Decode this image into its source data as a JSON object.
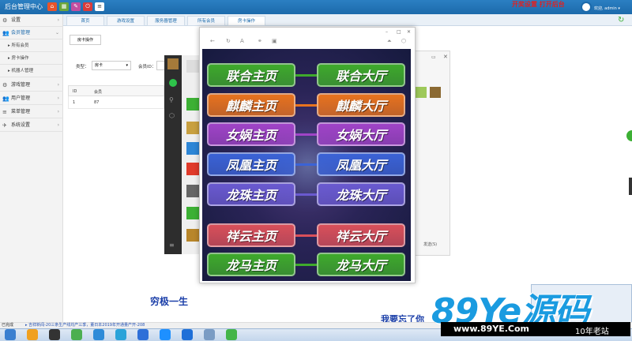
{
  "app": {
    "title": "后台管理中心",
    "top_hint": "开奖设置 打开后台",
    "welcome": "欢迎, admin ▾"
  },
  "toolbar": [
    {
      "icon": "home-icon",
      "glyph": "⌂",
      "color": "#e8542b"
    },
    {
      "icon": "grid-icon",
      "glyph": "▦",
      "color": "#6aa53a"
    },
    {
      "icon": "edit-icon",
      "glyph": "✎",
      "color": "#c24ea0"
    },
    {
      "icon": "power-icon",
      "glyph": "⏻",
      "color": "#d93b3b"
    },
    {
      "icon": "list-icon",
      "glyph": "≡",
      "color": "#ffffff"
    }
  ],
  "sidebar": {
    "items": [
      {
        "label": "设置",
        "icon": "⚙"
      },
      {
        "label": "会员管理",
        "icon": "👥"
      },
      {
        "label": "所有会员",
        "sub": true
      },
      {
        "label": "房卡操作",
        "sub": true
      },
      {
        "label": "机器人管理",
        "sub": true
      },
      {
        "label": "游戏管理",
        "icon": "⚙"
      },
      {
        "label": "用户管理",
        "icon": "👥"
      },
      {
        "label": "菜单管理",
        "icon": "≡"
      },
      {
        "label": "系统设置",
        "icon": "✈"
      }
    ]
  },
  "tabs": [
    {
      "label": "首页"
    },
    {
      "label": "游戏设置"
    },
    {
      "label": "服务器管理"
    },
    {
      "label": "所有会员"
    },
    {
      "label": "房卡操作",
      "active": true
    }
  ],
  "content": {
    "subtab": "房卡操作",
    "filter_type_label": "类型：",
    "filter_type_value": "房卡",
    "filter_member_label": "会员ID：",
    "table_headers": [
      "ID",
      "会员"
    ],
    "table_rows": [
      [
        "1",
        "87"
      ]
    ]
  },
  "game": {
    "buttons": [
      {
        "left": "联合主页",
        "right": "联合大厅",
        "color": "#3faa2c"
      },
      {
        "left": "麒麟主页",
        "right": "麒麟大厅",
        "color": "#e8731f"
      },
      {
        "left": "女娲主页",
        "right": "女娲大厅",
        "color": "#a044c7"
      },
      {
        "left": "凤凰主页",
        "right": "凤凰大厅",
        "color": "#3b63d6"
      },
      {
        "left": "龙珠主页",
        "right": "龙珠大厅",
        "color": "#6a5ad0"
      },
      {
        "left": "祥云主页",
        "right": "祥云大厅",
        "color": "#d9505a"
      },
      {
        "left": "龙马主页",
        "right": "龙马大厅",
        "color": "#3faa2c"
      }
    ]
  },
  "right_window": {
    "send": "发送(S)"
  },
  "bottom": {
    "caption1": "穷极一生",
    "caption2": "我要忘了你",
    "status_ready": "已完成",
    "status_news": "▸ 吉祥新闻-20三条生产线均产三季，董日本2019年开通量产开-208"
  },
  "watermark": {
    "main": "89Ye源码",
    "url": "www.89YE.Com",
    "years": "10年老站"
  },
  "taskbar": [
    {
      "icon": "start-icon",
      "color": "#3a7fd0"
    },
    {
      "icon": "browser-icon",
      "color": "#f0a020"
    },
    {
      "icon": "g-app-icon",
      "color": "#333333"
    },
    {
      "icon": "green-app-icon",
      "color": "#4caf50"
    },
    {
      "icon": "bird-icon",
      "color": "#2e8bd8"
    },
    {
      "icon": "p-app-icon",
      "color": "#2aa3d9"
    },
    {
      "icon": "baidu-icon",
      "color": "#2e6fd8"
    },
    {
      "icon": "s-app-icon",
      "color": "#1e90ff"
    },
    {
      "icon": "k-app-icon",
      "color": "#1e6fd8"
    },
    {
      "icon": "window-icon",
      "color": "#7a9cc4"
    },
    {
      "icon": "wechat-icon",
      "color": "#44b549"
    }
  ]
}
